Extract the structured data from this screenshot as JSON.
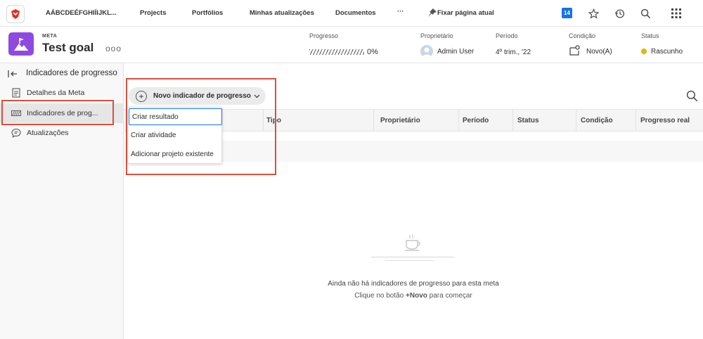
{
  "topbar": {
    "logo_icon": "adobe-workfront-logo",
    "nav": [
      "AÁBCDEÉFGHIÍIJKL...",
      "Projects",
      "Portfólios",
      "Minhas atualizações",
      "Documentos"
    ],
    "more": "···",
    "pin_label": "Fixar página atual",
    "badge": "14"
  },
  "header": {
    "type_label": "META",
    "title": "Test goal",
    "more": "ooo",
    "progress": {
      "label": "Progresso",
      "value": "0%",
      "fraction": 0
    },
    "owner": {
      "label": "Proprietário",
      "value": "Admin User"
    },
    "period": {
      "label": "Período",
      "value": "4º trim., '22"
    },
    "condition": {
      "label": "Condição",
      "value": "Novo(A)"
    },
    "status": {
      "label": "Status",
      "value": "Rascunho",
      "color": "#e0b800"
    }
  },
  "sidebar": {
    "heading": "Indicadores de progresso",
    "items": [
      {
        "label": "Detalhes da Meta",
        "icon": "document-icon"
      },
      {
        "label": "Indicadores de prog...",
        "icon": "progress-bar-icon",
        "active": true
      },
      {
        "label": "Atualizações",
        "icon": "chat-bubble-icon"
      }
    ]
  },
  "main": {
    "new_button": "Novo indicador de progresso",
    "columns": [
      "Tipo",
      "Proprietário",
      "Período",
      "Status",
      "Condição",
      "Progresso real"
    ],
    "dropdown": [
      "Criar resultado",
      "Criar atividade",
      "Adicionar projeto existente"
    ],
    "empty_title": "Ainda não há indicadores de progresso para esta meta",
    "empty_hint_pre": "Clique no botão ",
    "empty_hint_bold": "+Novo",
    "empty_hint_post": " para começar"
  },
  "colors": {
    "accent": "#1473e6",
    "highlight": "#d9503c",
    "goal_icon": "#8e4ae0"
  }
}
